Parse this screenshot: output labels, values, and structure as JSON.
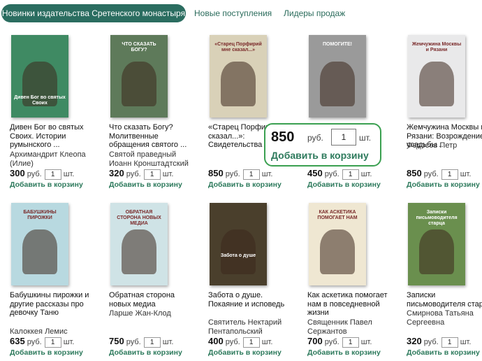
{
  "tabs": [
    {
      "label": "Новинки издательства Сретенского монастыря"
    },
    {
      "label": "Новые поступления"
    },
    {
      "label": "Лидеры продаж"
    }
  ],
  "common": {
    "rub": "руб.",
    "sht": "шт.",
    "add": "Добавить в корзину",
    "qty": "1"
  },
  "books": [
    {
      "title": "Дивен Бог во святых Своих. Истории румынского ...",
      "author": "Архимандрит Клеопа (Илие)",
      "price": "300",
      "cover_title": "Дивен Бог во святых Своих",
      "cover_bg": "#3f8a63"
    },
    {
      "title": "Что сказать Богу? Молитвенные обращения святого ...",
      "author": "Святой праведный Иоанн Кронштадтский",
      "price": "320",
      "cover_title": "ЧТО СКАЗАТЬ БОГУ?",
      "cover_bg": "#5e7a5a"
    },
    {
      "title": "«Старец Порфирий мне сказал...»: Свидетельства ...",
      "author": "",
      "price": "850",
      "cover_title": "«Старец Порфирий мне сказал...»",
      "cover_bg": "#d9d1b8"
    },
    {
      "title": "",
      "author": "",
      "price": "450",
      "cover_title": "ПОМОГИТЕ!",
      "cover_bg": "#9a9a9a"
    },
    {
      "title": "Жемчужина Москвы и Рязани: Возрождение усадьбы ...",
      "author": "Федосов Петр",
      "price": "850",
      "cover_title": "Жемчужина Москвы и Рязани",
      "cover_bg": "#e9e9ea"
    },
    {
      "title": "Бабушкины пирожки и другие рассказы про девочку Таню",
      "author": "Калоккея Лемис",
      "price": "635",
      "cover_title": "БАБУШКИНЫ ПИРОЖКИ",
      "cover_bg": "#b8d9e0"
    },
    {
      "title": "Обратная сторона новых медиа",
      "author": "Ларше Жан-Клод",
      "price": "750",
      "cover_title": "ОБРАТНАЯ СТОРОНА НОВЫХ МЕДИА",
      "cover_bg": "#cfe3e6"
    },
    {
      "title": "Забота о душе. Покаяние и исповедь",
      "author": "Святитель Нектарий Пентапольский",
      "price": "400",
      "cover_title": "Забота о душе",
      "cover_bg": "#4a3f2c"
    },
    {
      "title": "Как аскетика помогает нам в повседневной жизни",
      "author": "Священник Павел Сержантов",
      "price": "700",
      "cover_title": "КАК АСКЕТИКА ПОМОГАЕТ НАМ",
      "cover_bg": "#efe7d2"
    },
    {
      "title": "Записки письмоводителя старца",
      "author": "Смирнова Татьяна Сергеевна",
      "price": "320",
      "cover_title": "Записки письмоводителя старца",
      "cover_bg": "#6a8f4e"
    }
  ],
  "callout": {
    "price": "850",
    "rub": "руб.",
    "qty": "1",
    "sht": "шт.",
    "add": "Добавить в корзину"
  }
}
